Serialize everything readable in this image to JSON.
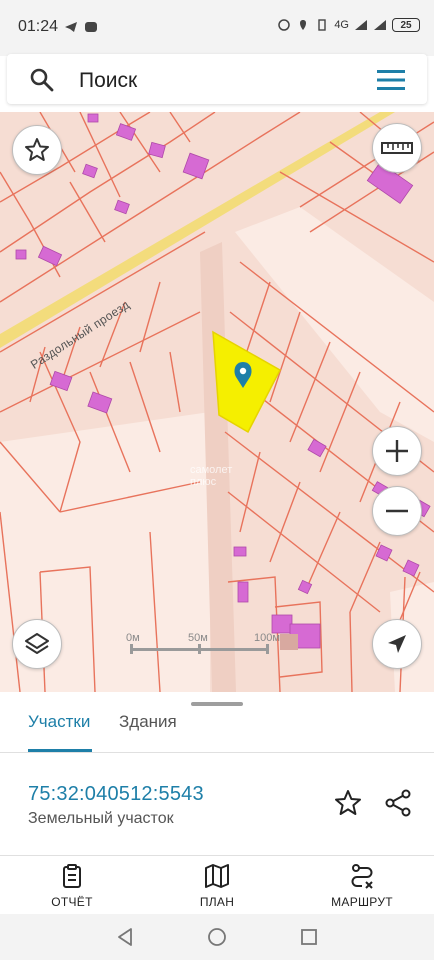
{
  "status_bar": {
    "time": "01:24",
    "battery": "25",
    "network": "4G"
  },
  "search": {
    "placeholder": "Поиск"
  },
  "map": {
    "road_label": "Раздольный проезд",
    "watermark_line1": "самолет",
    "watermark_line2": "плюс",
    "scale": [
      "0м",
      "50м",
      "100м"
    ],
    "parcel_color": "#f5ef00",
    "marker_color": "#1e7fa8",
    "building_color": "#d66ad3",
    "boundary_color": "#e8735c",
    "road_color": "#f3dc7c"
  },
  "tabs": [
    {
      "label": "Участки",
      "active": true
    },
    {
      "label": "Здания",
      "active": false
    }
  ],
  "parcel": {
    "cadastral_number": "75:32:040512:5543",
    "type": "Земельный участок"
  },
  "actions": [
    {
      "label": "ОТЧЁТ",
      "icon": "report-icon"
    },
    {
      "label": "ПЛАН",
      "icon": "map-plan-icon"
    },
    {
      "label": "МАРШРУТ",
      "icon": "route-icon"
    }
  ],
  "colors": {
    "accent": "#1e7fa8"
  }
}
